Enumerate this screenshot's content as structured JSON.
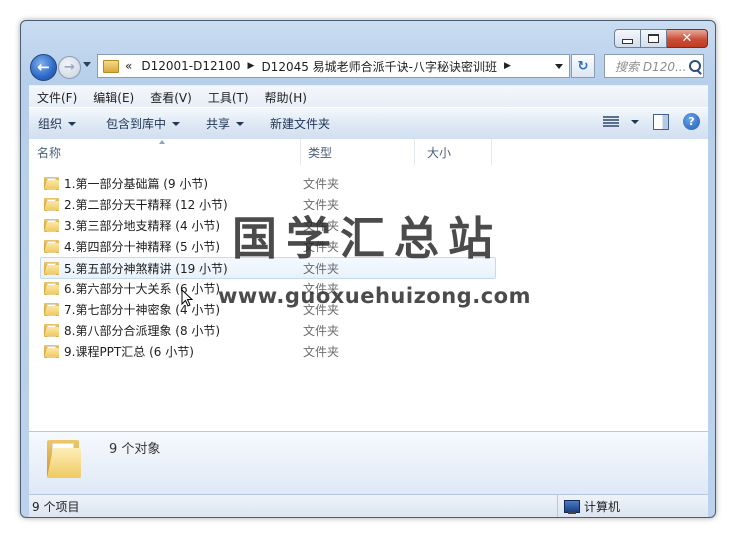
{
  "window": {
    "close_glyph": "✕"
  },
  "nav": {
    "back_glyph": "←",
    "forward_glyph": "→",
    "overflow": "«",
    "crumbs": [
      "D12001-D12100",
      "D12045 易城老师合派千诀-八字秘诀密训班"
    ],
    "crumb_sep": "▶",
    "refresh_glyph": "↻",
    "search_placeholder": "搜索 D120..."
  },
  "menu": [
    "文件(F)",
    "编辑(E)",
    "查看(V)",
    "工具(T)",
    "帮助(H)"
  ],
  "toolbar": {
    "organize": "组织",
    "include_library": "包含到库中",
    "share": "共享",
    "new_folder": "新建文件夹",
    "help_glyph": "?"
  },
  "columns": {
    "name": "名称",
    "type": "类型",
    "size": "大小"
  },
  "files": [
    {
      "name": "1.第一部分基础篇 (9 小节)",
      "type": "文件夹"
    },
    {
      "name": "2.第二部分天干精释 (12 小节)",
      "type": "文件夹"
    },
    {
      "name": "3.第三部分地支精释 (4 小节)",
      "type": "文件夹"
    },
    {
      "name": "4.第四部分十神精释 (5 小节)",
      "type": "文件夹"
    },
    {
      "name": "5.第五部分神煞精讲 (19 小节)",
      "type": "文件夹"
    },
    {
      "name": "6.第六部分十大关系 (6 小节)",
      "type": "文件夹"
    },
    {
      "name": "7.第七部分十神密象 (4 小节)",
      "type": "文件夹"
    },
    {
      "name": "8.第八部分合派理象 (8 小节)",
      "type": "文件夹"
    },
    {
      "name": "9.课程PPT汇总 (6 小节)",
      "type": "文件夹"
    }
  ],
  "watermark": {
    "cn": "国学汇总站",
    "en": "www.guoxuehuizong.com"
  },
  "details": {
    "count": "9 个对象"
  },
  "status": {
    "items": "9 个项目",
    "location": "计算机"
  },
  "colors": {
    "window_frame": "#b7cfea",
    "close_button": "#c94e36",
    "folder": "#eec75c"
  }
}
